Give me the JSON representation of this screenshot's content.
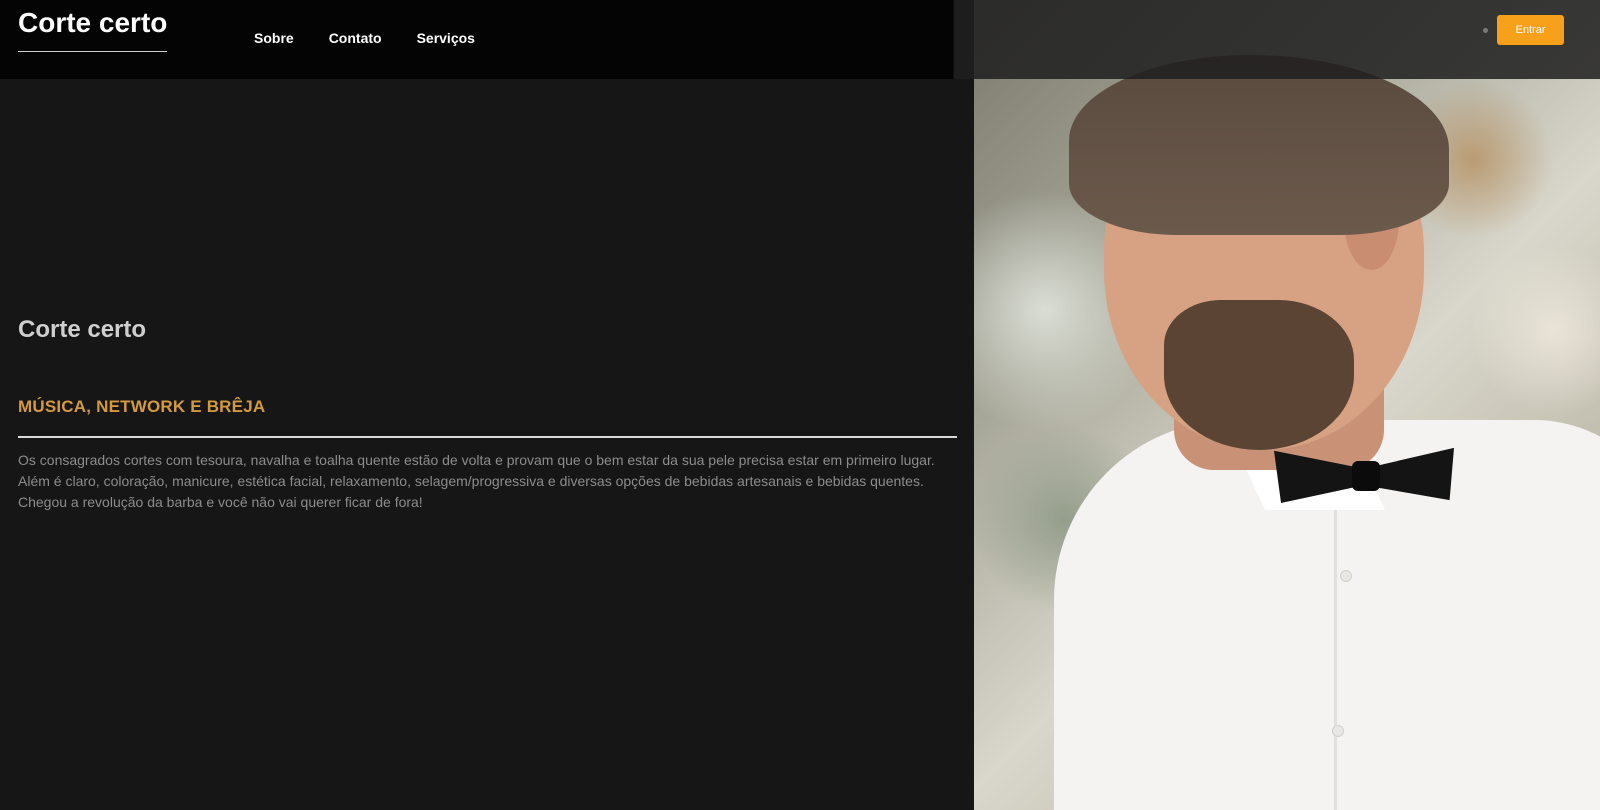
{
  "brand": {
    "name": "Corte certo"
  },
  "nav": {
    "items": [
      {
        "label": "Sobre"
      },
      {
        "label": "Contato"
      },
      {
        "label": "Serviços"
      }
    ],
    "login_label": "Entrar"
  },
  "hero": {
    "title": "Corte certo",
    "subtitle": "MÚSICA, NETWORK E BRÊJA",
    "lines": [
      "Os consagrados cortes com tesoura, navalha e toalha quente estão de volta e provam que o bem estar da sua pele precisa estar em primeiro lugar.",
      "Além é claro, coloração, manicure, estética facial, relaxamento, selagem/progressiva e diversas opções de bebidas artesanais e bebidas quentes.",
      "Chegou a revolução da barba e você não vai querer ficar de fora!"
    ]
  },
  "colors": {
    "accent": "#f7a01a",
    "subtitle": "#d49a3e",
    "background": "#161616"
  }
}
